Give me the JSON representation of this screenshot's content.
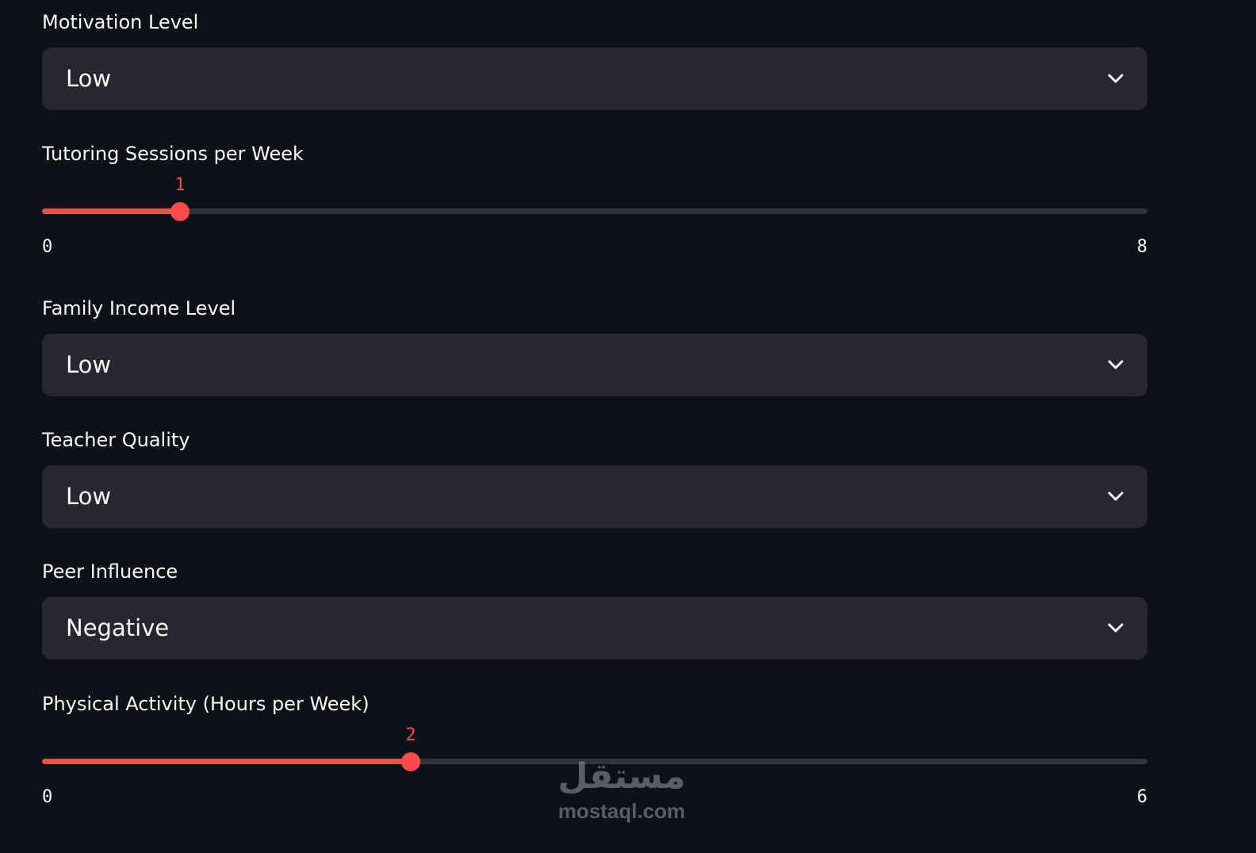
{
  "form": {
    "motivation": {
      "label": "Motivation Level",
      "value": "Low"
    },
    "tutoring": {
      "label": "Tutoring Sessions per Week",
      "value": "1",
      "min": "0",
      "max": "8",
      "fraction": 0.125
    },
    "family_income": {
      "label": "Family Income Level",
      "value": "Low"
    },
    "teacher_quality": {
      "label": "Teacher Quality",
      "value": "Low"
    },
    "peer_influence": {
      "label": "Peer Influence",
      "value": "Negative"
    },
    "physical_activity": {
      "label": "Physical Activity (Hours per Week)",
      "value": "2",
      "min": "0",
      "max": "6",
      "fraction": 0.3333
    }
  },
  "icons": {
    "dropdown": "chevron-down-icon"
  },
  "colors": {
    "background": "#0e1117",
    "input_background": "#262730",
    "accent": "#ff4b4b",
    "track": "#31333f",
    "text": "#fafafa"
  },
  "watermark": {
    "arabic": "مستقل",
    "latin": "mostaql.com"
  }
}
